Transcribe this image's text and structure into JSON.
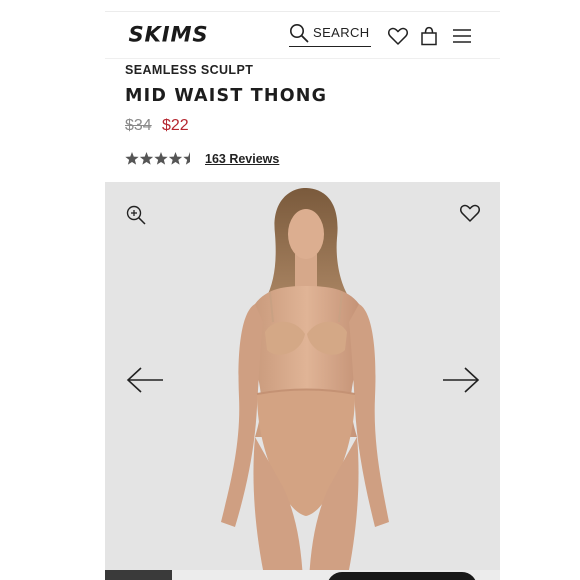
{
  "header": {
    "logo_text": "SKIMS",
    "search_label": "SEARCH",
    "icons": [
      "search-icon",
      "heart-icon",
      "bag-icon",
      "menu-icon"
    ]
  },
  "product": {
    "collection": "SEAMLESS SCULPT",
    "name": "MID WAIST THONG",
    "original_price": "$34",
    "sale_price": "$22",
    "rating": 4.5,
    "rating_max": 5,
    "reviews_label": "163 Reviews"
  },
  "gallery": {
    "icons": [
      "zoom-in-icon",
      "heart-icon",
      "arrow-left-icon",
      "arrow-right-icon"
    ],
    "progress": 0.17
  },
  "colors": {
    "sale": "#b5252e",
    "text": "#111111",
    "background_image": "#e4e4e4"
  }
}
